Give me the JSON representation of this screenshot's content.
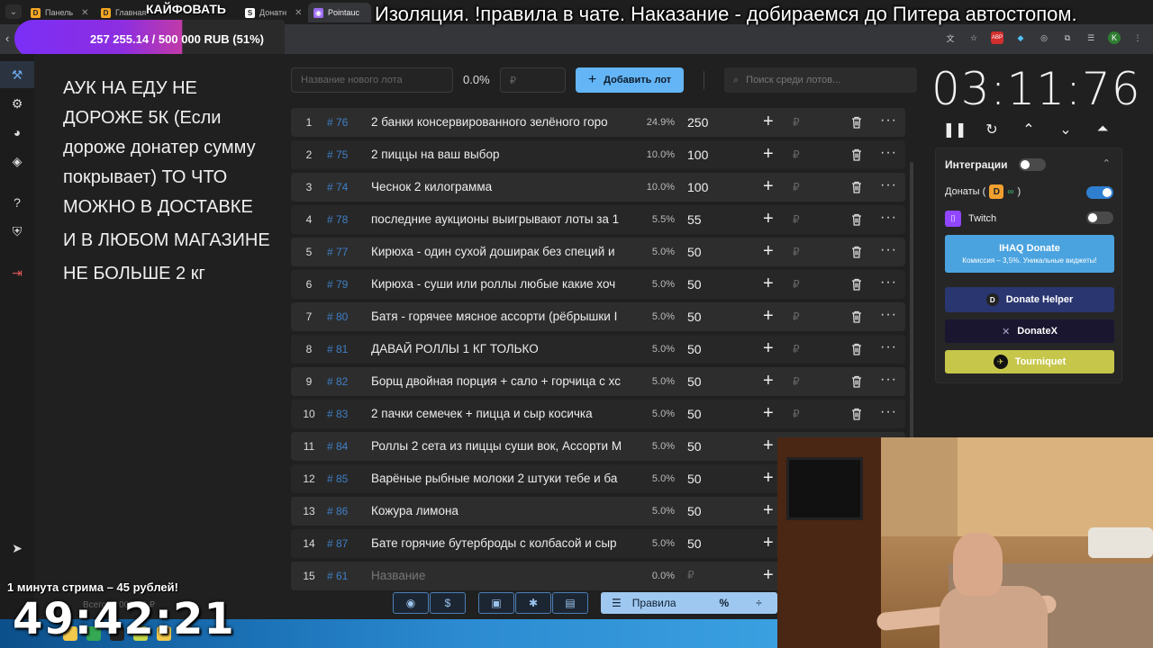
{
  "browser": {
    "tabs": [
      {
        "label": "Панель",
        "fav": "D",
        "color": "#f5a623"
      },
      {
        "label": "Главная",
        "fav": "D",
        "color": "#f5a623"
      },
      {
        "label": "Донатн",
        "fav": "S",
        "color": "#ffffff"
      },
      {
        "label": "Pointauc",
        "fav": "◉",
        "color": "#9c6cf0"
      }
    ]
  },
  "overlay": {
    "kaif": "КАЙФОВАТЬ",
    "money": "257 255.14 / 500 000 RUB (51%)",
    "money_progress": 0.51,
    "caption": "Изоляция. !правила в чате. Наказание - добираемся до Питера автостопом.",
    "promo": "1 минута стрима – 45 рублей!",
    "big_timer": "49:42:21",
    "faded": "Всего: 1 005.00 ₽"
  },
  "rules": [
    "АУК НА ЕДУ НЕ ДОРОЖЕ 5К (Если дороже донатер сумму покрывает) ТО ЧТО МОЖНО В ДОСТАВКЕ",
    "И В ЛЮБОМ МАГАЗИНЕ",
    "НЕ БОЛЬШЕ 2 кг"
  ],
  "controls": {
    "lot_name_placeholder": "Название нового лота",
    "pct": "0.0%",
    "amount_placeholder": "₽",
    "add_button": "Добавить лот",
    "search_placeholder": "Поиск среди лотов..."
  },
  "lots": [
    {
      "num": "1",
      "id": "# 76",
      "name": "2 банки консервированного зелёного горо",
      "pct": "24.9%",
      "amount": "250"
    },
    {
      "num": "2",
      "id": "# 75",
      "name": "2 пиццы на ваш выбор",
      "pct": "10.0%",
      "amount": "100"
    },
    {
      "num": "3",
      "id": "# 74",
      "name": "Чеснок 2 килограмма",
      "pct": "10.0%",
      "amount": "100"
    },
    {
      "num": "4",
      "id": "# 78",
      "name": "последние аукционы выигрывают лоты за 1",
      "pct": "5.5%",
      "amount": "55"
    },
    {
      "num": "5",
      "id": "# 77",
      "name": "Кирюха - один сухой доширак без специй и",
      "pct": "5.0%",
      "amount": "50"
    },
    {
      "num": "6",
      "id": "# 79",
      "name": "Кирюха - суши или роллы любые какие хоч",
      "pct": "5.0%",
      "amount": "50"
    },
    {
      "num": "7",
      "id": "# 80",
      "name": "Батя - горячее мясное ассорти (рёбрышки I",
      "pct": "5.0%",
      "amount": "50"
    },
    {
      "num": "8",
      "id": "# 81",
      "name": "ДАВАЙ РОЛЛЫ 1 КГ ТОЛЬКО",
      "pct": "5.0%",
      "amount": "50"
    },
    {
      "num": "9",
      "id": "# 82",
      "name": "Борщ двойная порция + сало + горчица с хс",
      "pct": "5.0%",
      "amount": "50"
    },
    {
      "num": "10",
      "id": "# 83",
      "name": "2 пачки семечек + пицца и сыр косичка",
      "pct": "5.0%",
      "amount": "50"
    },
    {
      "num": "11",
      "id": "# 84",
      "name": "Роллы 2 сета из пиццы суши вок, Ассорти М",
      "pct": "5.0%",
      "amount": "50"
    },
    {
      "num": "12",
      "id": "# 85",
      "name": "Варёные рыбные молоки 2 штуки тебе и ба",
      "pct": "5.0%",
      "amount": "50"
    },
    {
      "num": "13",
      "id": "# 86",
      "name": "Кожура лимона",
      "pct": "5.0%",
      "amount": "50"
    },
    {
      "num": "14",
      "id": "# 87",
      "name": "Бате горячие бутерброды с колбасой и сыр",
      "pct": "5.0%",
      "amount": "50"
    },
    {
      "num": "15",
      "id": "# 61",
      "name": "Название",
      "pct": "0.0%",
      "amount": "₽"
    }
  ],
  "currency": "₽",
  "bottom": {
    "rules_label": "Правила",
    "pct_label": "%"
  },
  "timer": "03:11:76",
  "integrations": {
    "title": "Интеграции",
    "donations_label": "Донаты (",
    "donations_suffix": ")",
    "twitch_label": "Twitch",
    "ihaq_title": "IHAQ Donate",
    "ihaq_sub": "Комиссия – 3,5%. Уникальные виджеты!",
    "donate_helper": "Donate Helper",
    "donatex": "DonateX",
    "tourniquet": "Tourniquet"
  },
  "colors": {
    "accent": "#64b5f6",
    "brand_purple": "#7b2ff7",
    "id_blue": "#3f7fc6"
  }
}
